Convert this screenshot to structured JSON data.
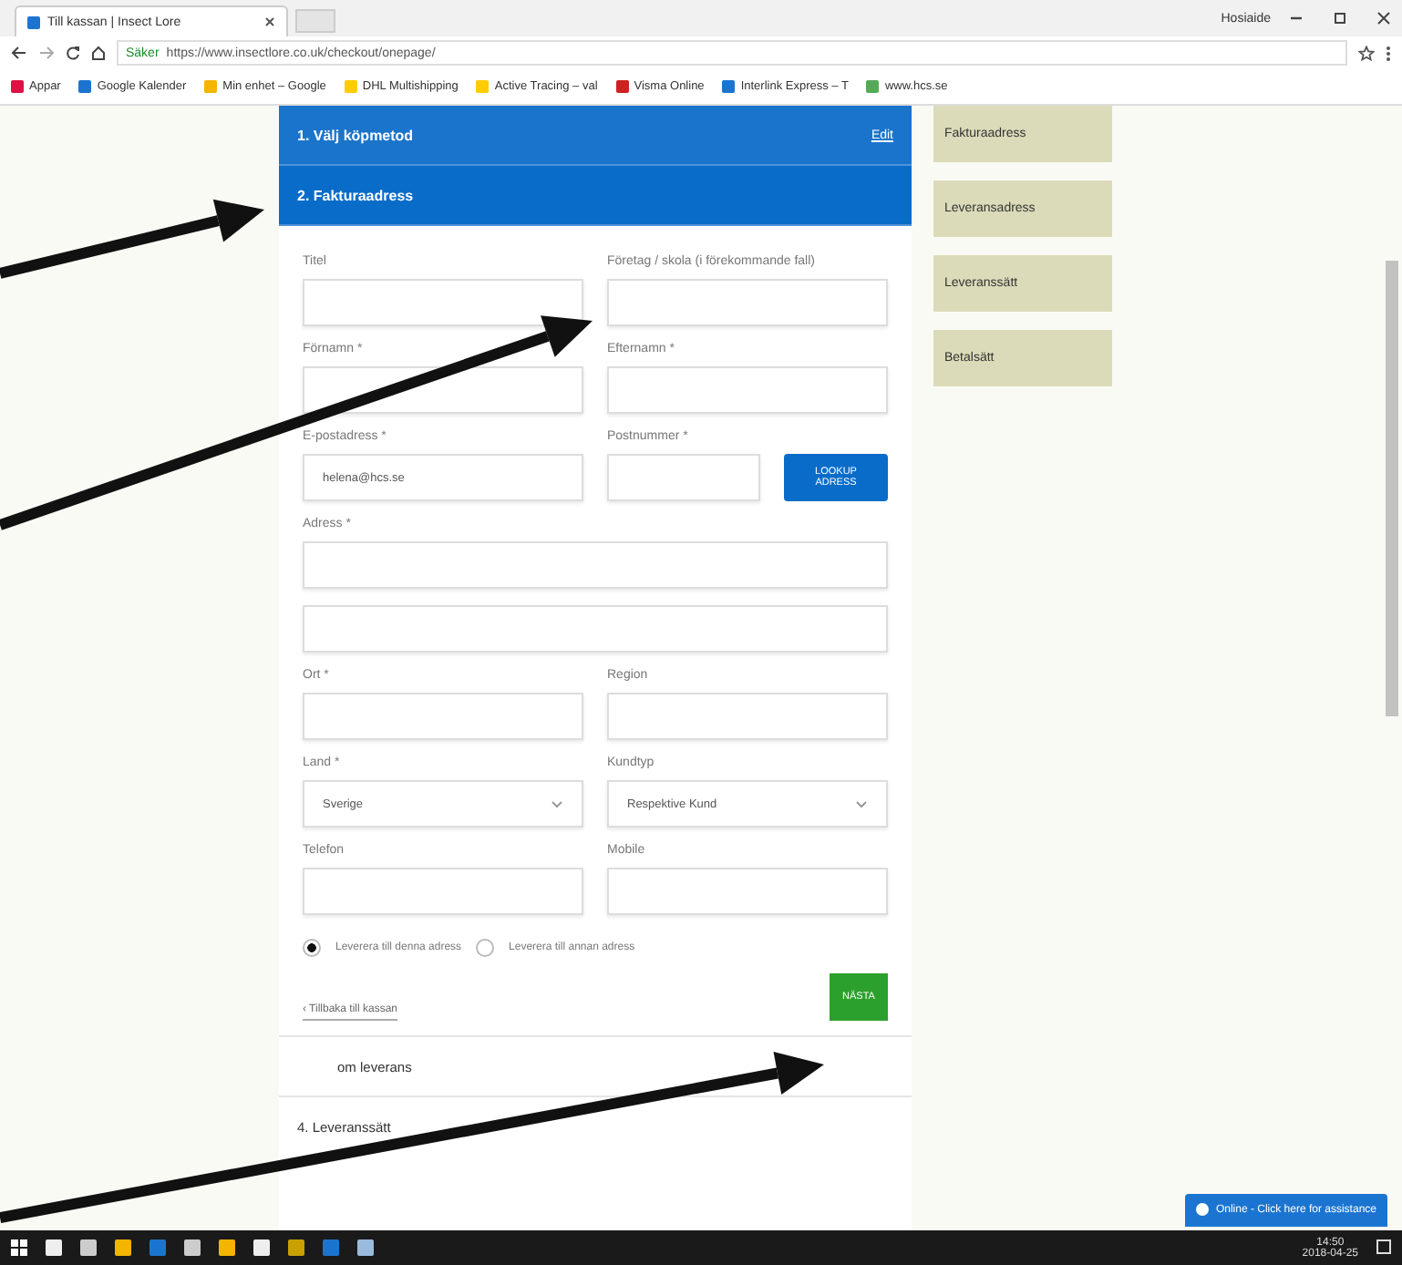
{
  "browser": {
    "tab_title": "Till kassan | Insect Lore",
    "user": "Hosiaide",
    "secure_label": "Säker",
    "url": "https://www.insectlore.co.uk/checkout/onepage/",
    "bookmarks": [
      "Appar",
      "Google Kalender",
      "Min enhet – Google",
      "DHL Multishipping",
      "Active Tracing – val",
      "Visma Online",
      "Interlink Express – T",
      "www.hcs.se"
    ]
  },
  "checkout": {
    "sections_top": [
      {
        "title": "1. Välj köpmetod",
        "action": "Edit",
        "active": false
      },
      {
        "title": "2. Fakturaadress",
        "active": true
      }
    ],
    "rows": [
      [
        {
          "label": "Titel",
          "kind": "input"
        },
        {
          "label": "Företag / skola (i förekommande fall)",
          "kind": "input"
        }
      ],
      [
        {
          "label": "Förnamn *",
          "kind": "input"
        },
        {
          "label": "Efternamn *",
          "kind": "input"
        }
      ],
      [
        {
          "label": "E-postadress *",
          "kind": "input",
          "value": "helena@hcs.se"
        },
        {
          "label": "Postnummer *",
          "kind": "lookup",
          "button": "LOOKUP ADRESS"
        }
      ],
      [
        {
          "label": "Adress *",
          "kind": "wide"
        }
      ],
      [
        {
          "kind": "wide"
        }
      ],
      [
        {
          "label": "Ort *",
          "kind": "input"
        },
        {
          "label": "Region",
          "kind": "input"
        }
      ],
      [
        {
          "label": "Land *",
          "kind": "select",
          "value": "Sverige"
        },
        {
          "label": "Kundtyp",
          "kind": "select",
          "value": "Respektive Kund"
        }
      ],
      [
        {
          "label": "Telefon",
          "kind": "input"
        },
        {
          "label": "Mobile",
          "kind": "input"
        }
      ]
    ],
    "delivery_options": [
      {
        "label": "Leverera till denna adress",
        "selected": true
      },
      {
        "label": "Leverera till annan adress",
        "selected": false
      }
    ],
    "back_link": "‹ Tillbaka till kassan",
    "next_button": "NÄSTA",
    "sections_bottom": [
      "om leverans",
      "4. Leveranssätt"
    ]
  },
  "progress_sidebar": [
    "Fakturaadress",
    "Leveransadress",
    "Leveranssätt",
    "Betalsätt"
  ],
  "chat_button": "Online - Click here for assistance",
  "taskbar": {
    "time": "14:50",
    "date": "2018-04-25"
  }
}
